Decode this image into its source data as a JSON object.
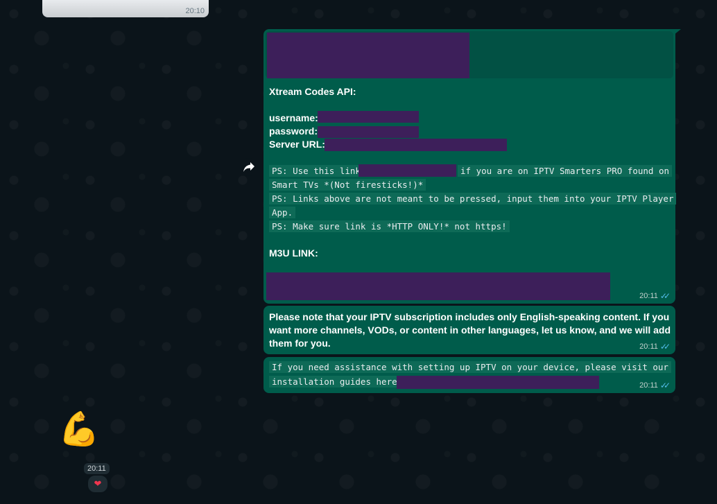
{
  "previous_message": {
    "time": "20:10"
  },
  "message1": {
    "heading": "Xtream Codes API:",
    "username_label": "username:",
    "password_label": "password:",
    "server_url_label": "Server URL:",
    "ps1_before": "PS: Use this link",
    "ps1_after": "if you are on IPTV Smarters PRO found on",
    "ps1_line2": "Smart TVs *(Not firesticks!)*",
    "ps2_line1": "PS: Links above are not meant to be pressed, input them into your IPTV Player",
    "ps2_line2": "App.",
    "ps3": "PS: Make sure link is *HTTP ONLY!* not https!",
    "m3u_label": "M3U LINK:",
    "time": "20:11"
  },
  "message2": {
    "text": "Please note that your IPTV subscription includes only English-speaking content. If you want more channels, VODs, or content in other languages, let us know, and we will add them for you.",
    "time": "20:11"
  },
  "message3": {
    "line1": "If you need assistance with setting up IPTV on your device, please visit our",
    "line2": "installation guides here:",
    "time": "20:11"
  },
  "emoji_message": {
    "emoji": "💪",
    "time": "20:11",
    "reaction": "❤"
  },
  "icons": {
    "forward": "forward-icon",
    "read_receipt": "double-check-icon",
    "reaction": "heart-icon"
  },
  "colors": {
    "background": "#0b141a",
    "outgoing_bubble": "#005c4b",
    "redaction": "#3d1f5a",
    "read_ticks": "#53bdeb"
  }
}
